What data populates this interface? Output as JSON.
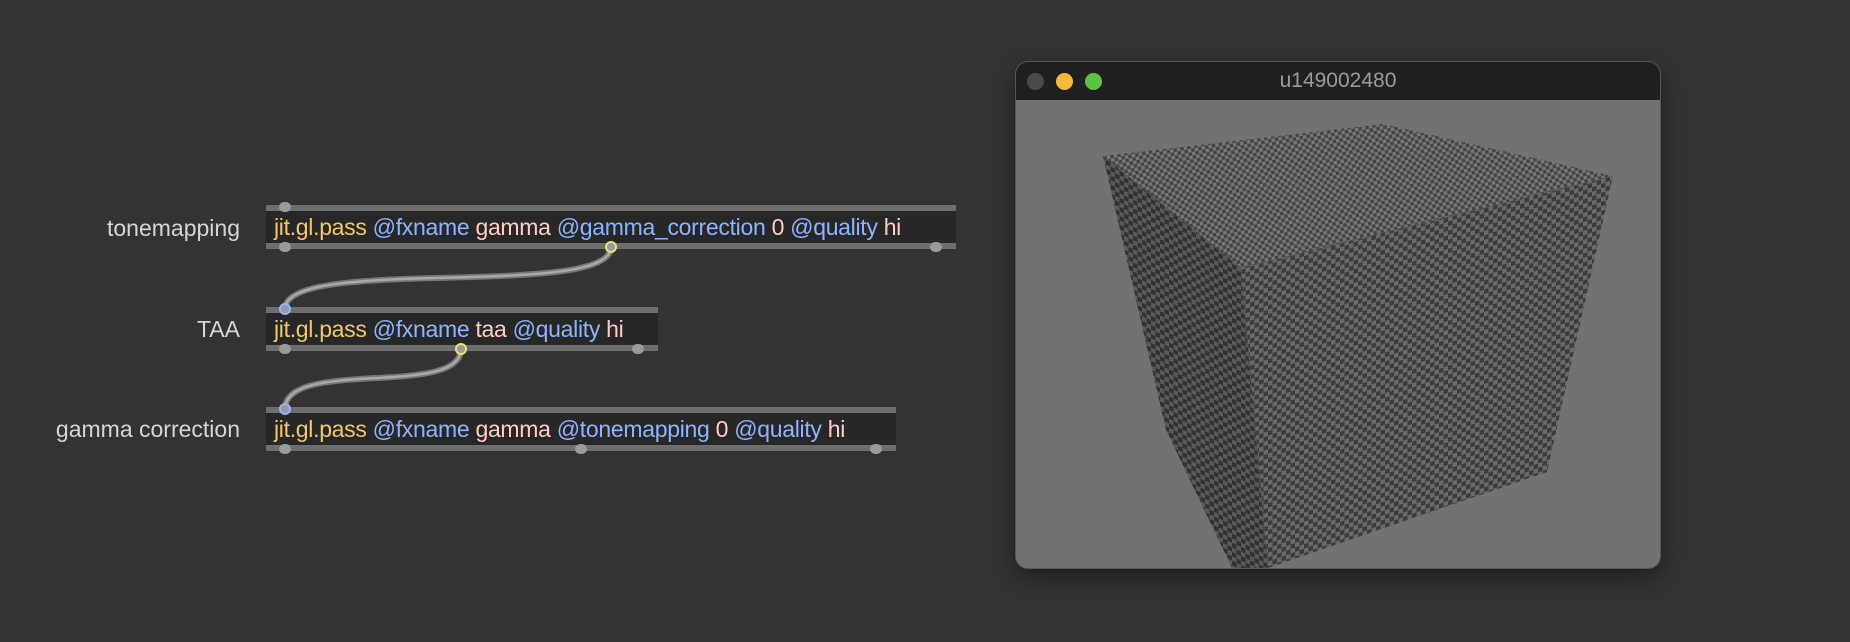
{
  "comments": {
    "tonemapping": "tonemapping",
    "taa": "TAA",
    "gamma_correction": "gamma correction"
  },
  "objects": {
    "obj1": {
      "class": "jit.gl.pass",
      "attr1": "@fxname",
      "arg1": "gamma",
      "attr2": "@gamma_correction",
      "arg2": "0",
      "attr3": "@quality",
      "arg3": "hi"
    },
    "obj2": {
      "class": "jit.gl.pass",
      "attr1": "@fxname",
      "arg1": "taa",
      "attr2": "@quality",
      "arg2": "hi"
    },
    "obj3": {
      "class": "jit.gl.pass",
      "attr1": "@fxname",
      "arg1": "gamma",
      "attr2": "@tonemapping",
      "arg2": "0",
      "attr3": "@quality",
      "arg3": "hi"
    }
  },
  "window": {
    "title": "u149002480",
    "buttons": [
      "close-button",
      "minimize-button",
      "zoom-button"
    ]
  },
  "colors": {
    "background": "#333333",
    "object_class": "#f3c76b",
    "object_attr": "#8fb4ff",
    "object_arg": "#ffcdc3",
    "close": "#4a4a4a",
    "minimize": "#f5b942",
    "zoom": "#5ac341",
    "viewport": "#727272"
  }
}
